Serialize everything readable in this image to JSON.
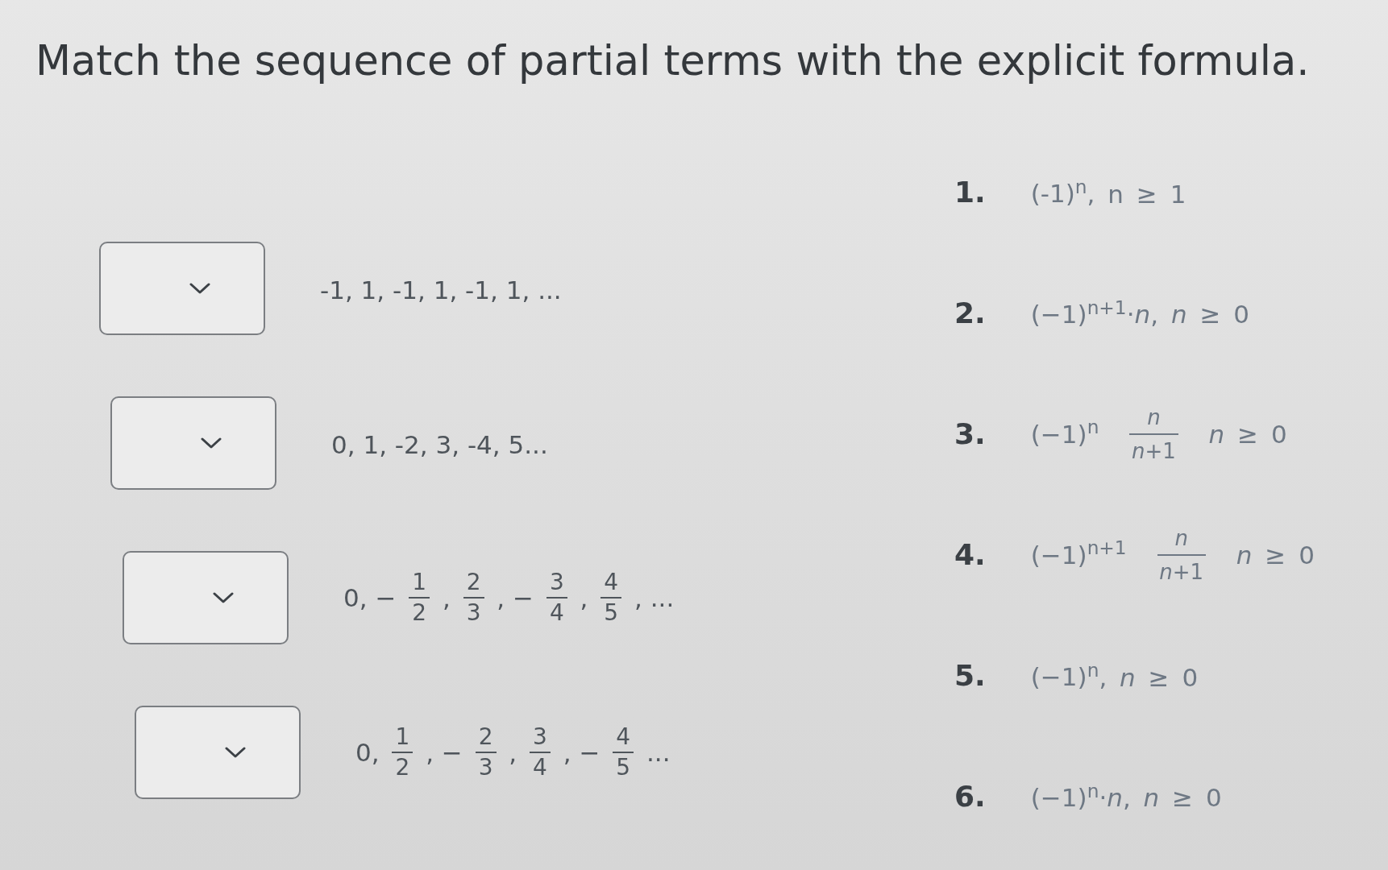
{
  "title": "Match the sequence of partial terms with the explicit formula.",
  "sequences": [
    {
      "parts": [
        {
          "kind": "text",
          "text": "-1, 1, -1, 1, -1, 1, ..."
        }
      ]
    },
    {
      "parts": [
        {
          "kind": "text",
          "text": "0, 1, -2, 3, -4, 5..."
        }
      ]
    },
    {
      "parts": [
        {
          "kind": "text",
          "text": "0, −"
        },
        {
          "kind": "fraction",
          "numerator": "1",
          "denominator": "2"
        },
        {
          "kind": "text",
          "text": ","
        },
        {
          "kind": "fraction",
          "numerator": "2",
          "denominator": "3"
        },
        {
          "kind": "text",
          "text": ", −"
        },
        {
          "kind": "fraction",
          "numerator": "3",
          "denominator": "4"
        },
        {
          "kind": "text",
          "text": ","
        },
        {
          "kind": "fraction",
          "numerator": "4",
          "denominator": "5"
        },
        {
          "kind": "text",
          "text": ", ..."
        }
      ]
    },
    {
      "parts": [
        {
          "kind": "text",
          "text": "0,"
        },
        {
          "kind": "fraction",
          "numerator": "1",
          "denominator": "2"
        },
        {
          "kind": "text",
          "text": ", −"
        },
        {
          "kind": "fraction",
          "numerator": "2",
          "denominator": "3"
        },
        {
          "kind": "text",
          "text": ","
        },
        {
          "kind": "fraction",
          "numerator": "3",
          "denominator": "4"
        },
        {
          "kind": "text",
          "text": ", −"
        },
        {
          "kind": "fraction",
          "numerator": "4",
          "denominator": "5"
        },
        {
          "kind": "text",
          "text": "..."
        }
      ]
    }
  ],
  "formulas": [
    {
      "number": "1.",
      "parts": [
        {
          "kind": "text",
          "text": "(-1)$^{n}$,"
        },
        {
          "kind": "text",
          "text": "n ≥ 1"
        }
      ]
    },
    {
      "number": "2.",
      "parts": [
        {
          "kind": "text",
          "text": "(−1)$^{n+1}$·*n*, *n* ≥ 0"
        }
      ]
    },
    {
      "number": "3.",
      "parts": [
        {
          "kind": "text",
          "text": "(−1)$^{n}$"
        },
        {
          "kind": "fraction",
          "numerator": "*n*",
          "denominator": "*n*+1"
        },
        {
          "kind": "text",
          "text": "*n* ≥ 0"
        }
      ]
    },
    {
      "number": "4.",
      "parts": [
        {
          "kind": "text",
          "text": "(−1)$^{n+1}$"
        },
        {
          "kind": "fraction",
          "numerator": "*n*",
          "denominator": "*n*+1"
        },
        {
          "kind": "text",
          "text": "*n* ≥ 0"
        }
      ]
    },
    {
      "number": "5.",
      "parts": [
        {
          "kind": "text",
          "text": "(−1)$^{n}$,"
        },
        {
          "kind": "text",
          "text": "*n* ≥ 0"
        }
      ]
    },
    {
      "number": "6.",
      "parts": [
        {
          "kind": "text",
          "text": "(−1)$^{n}$·*n*, *n* ≥ 0"
        }
      ]
    }
  ]
}
